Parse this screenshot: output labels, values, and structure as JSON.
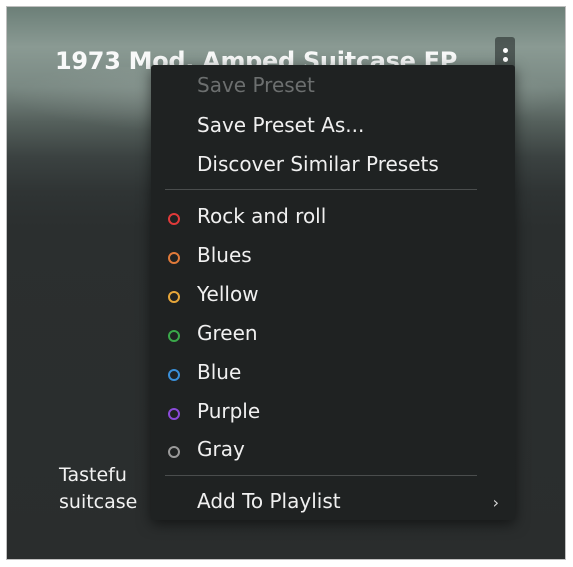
{
  "preset": {
    "title": "1973 Mod. Amped Suitcase EP",
    "description_line1": "Tastefu",
    "description_line2": "suitcase"
  },
  "menu": {
    "save_preset": "Save Preset",
    "save_preset_as": "Save Preset As...",
    "discover_similar": "Discover Similar Presets",
    "colors": [
      {
        "label": "Rock and roll",
        "color": "#e03a3a"
      },
      {
        "label": "Blues",
        "color": "#e07a3a"
      },
      {
        "label": "Yellow",
        "color": "#e6a63a"
      },
      {
        "label": "Green",
        "color": "#3aa84a"
      },
      {
        "label": "Blue",
        "color": "#3a8fd8"
      },
      {
        "label": "Purple",
        "color": "#8a4ad8"
      },
      {
        "label": "Gray",
        "color": "#9a9a9a"
      }
    ],
    "add_to_playlist": "Add To Playlist",
    "chevron": "›"
  }
}
